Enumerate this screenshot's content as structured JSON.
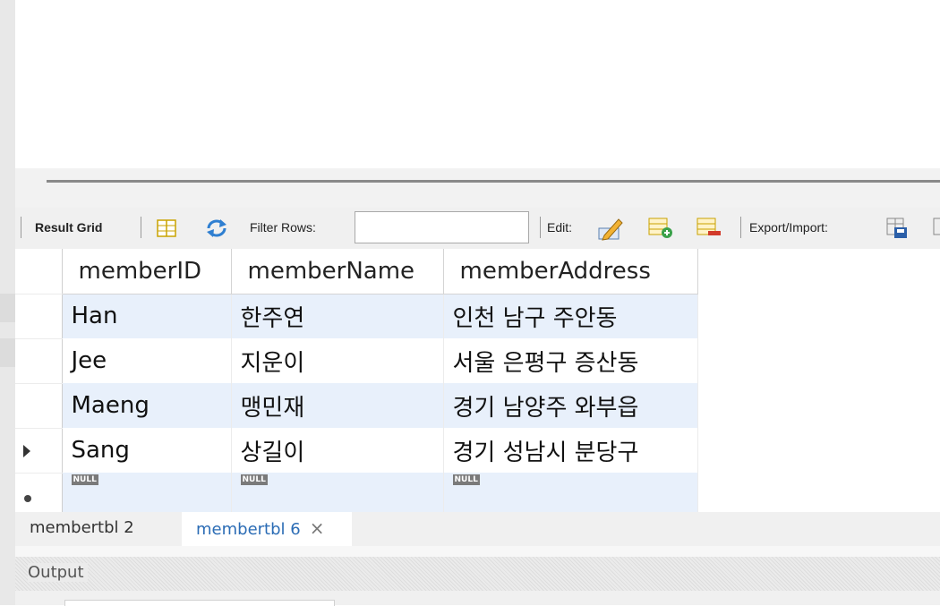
{
  "toolbar": {
    "result_grid_label": "Result Grid",
    "filter_rows_label": "Filter Rows:",
    "filter_value": "",
    "edit_label": "Edit:",
    "export_import_label": "Export/Import:"
  },
  "grid": {
    "columns": [
      "memberID",
      "memberName",
      "memberAddress"
    ],
    "rows": [
      [
        "Han",
        "한주연",
        "인천 남구 주안동"
      ],
      [
        "Jee",
        "지운이",
        "서울 은평구 증산동"
      ],
      [
        "Maeng",
        "맹민재",
        "경기 남양주 와부읍"
      ],
      [
        "Sang",
        "상길이",
        "경기 성남시 분당구"
      ]
    ],
    "new_row": [
      "NULL",
      "NULL",
      "NULL"
    ]
  },
  "tabs": [
    {
      "label": "membertbl 2"
    },
    {
      "label": "membertbl 6",
      "close": "×"
    }
  ],
  "output": {
    "label": "Output"
  },
  "colors": {
    "accent_tab": "#2b6cb5",
    "alt_row": "#e8f0fb"
  }
}
